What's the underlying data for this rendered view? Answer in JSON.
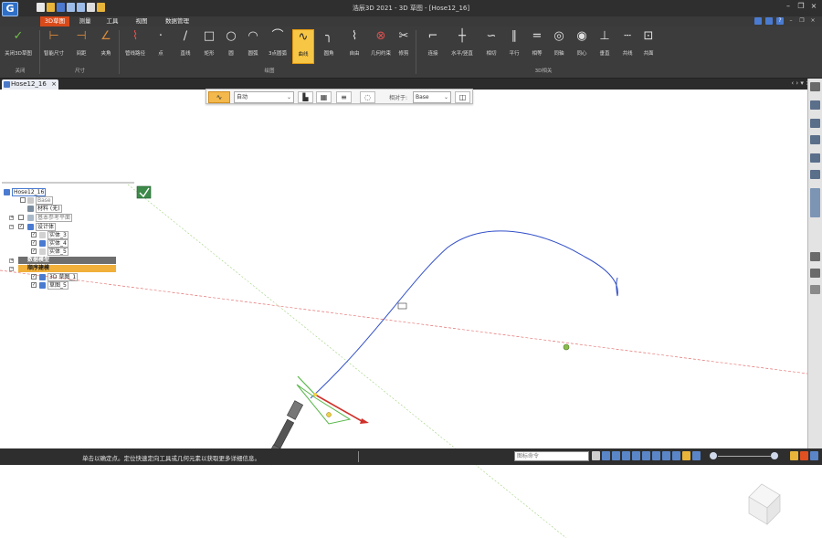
{
  "app": {
    "logo": "G",
    "title": "浩辰3D 2021 - 3D 草图 - [Hose12_16]"
  },
  "quick_access_icons": [
    "new-file-icon",
    "open-folder-icon",
    "save-icon",
    "undo-icon",
    "redo-icon",
    "print-icon",
    "settings-icon"
  ],
  "tabs": [
    {
      "label": "3D草图",
      "active": true
    },
    {
      "label": "测量",
      "active": false
    },
    {
      "label": "工具",
      "active": false
    },
    {
      "label": "视图",
      "active": false
    },
    {
      "label": "数据管理",
      "active": false
    }
  ],
  "ribbon": {
    "buttons": [
      {
        "label": "关闭3D草图",
        "icon": "close-sketch-icon",
        "color": "#6fbf4a"
      },
      {
        "label": "智能尺寸",
        "icon": "smart-dimension-icon",
        "color": "#d88a3a"
      },
      {
        "label": "间距",
        "icon": "distance-icon",
        "color": "#d88a3a"
      },
      {
        "label": "夹角",
        "icon": "angle-icon",
        "color": "#d88a3a"
      },
      {
        "label": "管线路径",
        "icon": "pipe-path-icon",
        "color": "#e05050"
      },
      {
        "label": "点",
        "icon": "point-icon",
        "color": "#e0e0e0"
      },
      {
        "label": "直线",
        "icon": "line-icon",
        "color": "#e0e0e0"
      },
      {
        "label": "矩形",
        "icon": "rectangle-icon",
        "color": "#e0e0e0"
      },
      {
        "label": "圆",
        "icon": "circle-icon",
        "color": "#e0e0e0"
      },
      {
        "label": "圆弧",
        "icon": "arc-icon",
        "color": "#e0e0e0"
      },
      {
        "label": "3点圆弧",
        "icon": "three-point-arc-icon",
        "color": "#e0e0e0"
      },
      {
        "label": "曲线",
        "icon": "curve-icon",
        "color": "#222222"
      },
      {
        "label": "圆角",
        "icon": "fillet-icon",
        "color": "#e0e0e0"
      },
      {
        "label": "自由",
        "icon": "free-icon",
        "color": "#e0e0e0"
      },
      {
        "label": "几何约束",
        "icon": "geometric-constraint-icon",
        "color": "#e05050"
      },
      {
        "label": "修剪",
        "icon": "trim-icon",
        "color": "#e0e0e0"
      },
      {
        "label": "连接",
        "icon": "connect-icon",
        "color": "#e0e0e0"
      },
      {
        "label": "水平/竖直",
        "icon": "horizontal-vertical-icon",
        "color": "#e0e0e0"
      },
      {
        "label": "相切",
        "icon": "tangent-icon",
        "color": "#e0e0e0"
      },
      {
        "label": "平行",
        "icon": "parallel-icon",
        "color": "#e0e0e0"
      },
      {
        "label": "相等",
        "icon": "equal-icon",
        "color": "#e0e0e0"
      },
      {
        "label": "同轴",
        "icon": "coaxial-icon",
        "color": "#e0e0e0"
      },
      {
        "label": "同心",
        "icon": "concentric-icon",
        "color": "#e0e0e0"
      },
      {
        "label": "垂直",
        "icon": "perpendicular-icon",
        "color": "#e0e0e0"
      },
      {
        "label": "共线",
        "icon": "collinear-icon",
        "color": "#e0e0e0"
      },
      {
        "label": "共面",
        "icon": "coplanar-icon",
        "color": "#e0e0e0"
      }
    ],
    "groups": [
      "关闭",
      "尺寸",
      "绘图",
      "3D相关"
    ]
  },
  "doc_tab": {
    "label": "Hose12_16",
    "close": "×"
  },
  "doc_nav": "‹ › ▾ ×",
  "tree": {
    "panel_items": [
      {
        "label": "Hose12_16",
        "level": 0
      },
      {
        "label": "Base",
        "level": 1
      },
      {
        "label": "材料 (无)",
        "level": 1
      },
      {
        "label": "基本参考平面",
        "level": 1
      },
      {
        "label": "设计体",
        "level": 1
      },
      {
        "label": "实体_3",
        "level": 2
      },
      {
        "label": "实体_4",
        "level": 2
      },
      {
        "label": "实体_5",
        "level": 2
      },
      {
        "label": "数据模型",
        "level": 0
      },
      {
        "label": "顺序建模",
        "level": 0
      },
      {
        "label": "3D 草图_1",
        "level": 1
      },
      {
        "label": "草图_5",
        "level": 1
      }
    ]
  },
  "sketch_toolbar": {
    "mode": "自动",
    "axis_label": "相对于:",
    "axis_value": "Base"
  },
  "status": {
    "message": "单击以确定点。定位快速定向工具或几何元素以获取更多详细信息。",
    "command_placeholder": "图标命令"
  },
  "colors": {
    "accent": "#d94a1a",
    "curve": "#3350c8",
    "axis_red": "#e05b5b",
    "axis_green": "#8ccc6a"
  }
}
